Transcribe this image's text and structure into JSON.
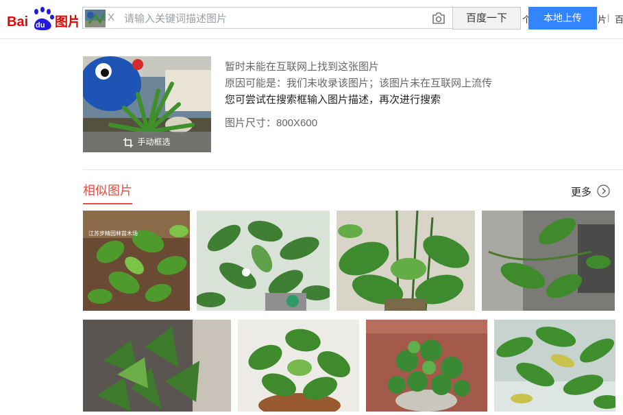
{
  "header": {
    "logo_text": "Bai du 图片",
    "search": {
      "placeholder": "请输入关键词描述图片",
      "close_label": "X"
    },
    "search_button_label": "百度一下",
    "upload_button_label": "本地上传",
    "top_links": [
      "个",
      "片",
      "百"
    ]
  },
  "result": {
    "crop_label": "手动框选",
    "messages": [
      "暂时未能在互联网上找到这张图片",
      "原因可能是：我们未收录该图片；该图片未在互联网上流传",
      "您可尝试在搜索框输入图片描述，再次进行搜索"
    ],
    "size_text": "图片尺寸：800X600"
  },
  "similar": {
    "title": "相似图片",
    "more_label": "更多",
    "images": [
      {
        "subject": "potted-pothos-plant",
        "watermark": "江苏步精园林苗木场"
      },
      {
        "subject": "green-plant-with-white-flower",
        "watermark": ""
      },
      {
        "subject": "large-leaf-potted-plant",
        "watermark": ""
      },
      {
        "subject": "plant-branch-by-wall",
        "watermark": ""
      },
      {
        "subject": "dark-leaf-plant",
        "watermark": ""
      },
      {
        "subject": "pothos-in-pot",
        "watermark": ""
      },
      {
        "subject": "peperomia-in-pot",
        "watermark": ""
      },
      {
        "subject": "green-leaves-close",
        "watermark": ""
      }
    ]
  }
}
